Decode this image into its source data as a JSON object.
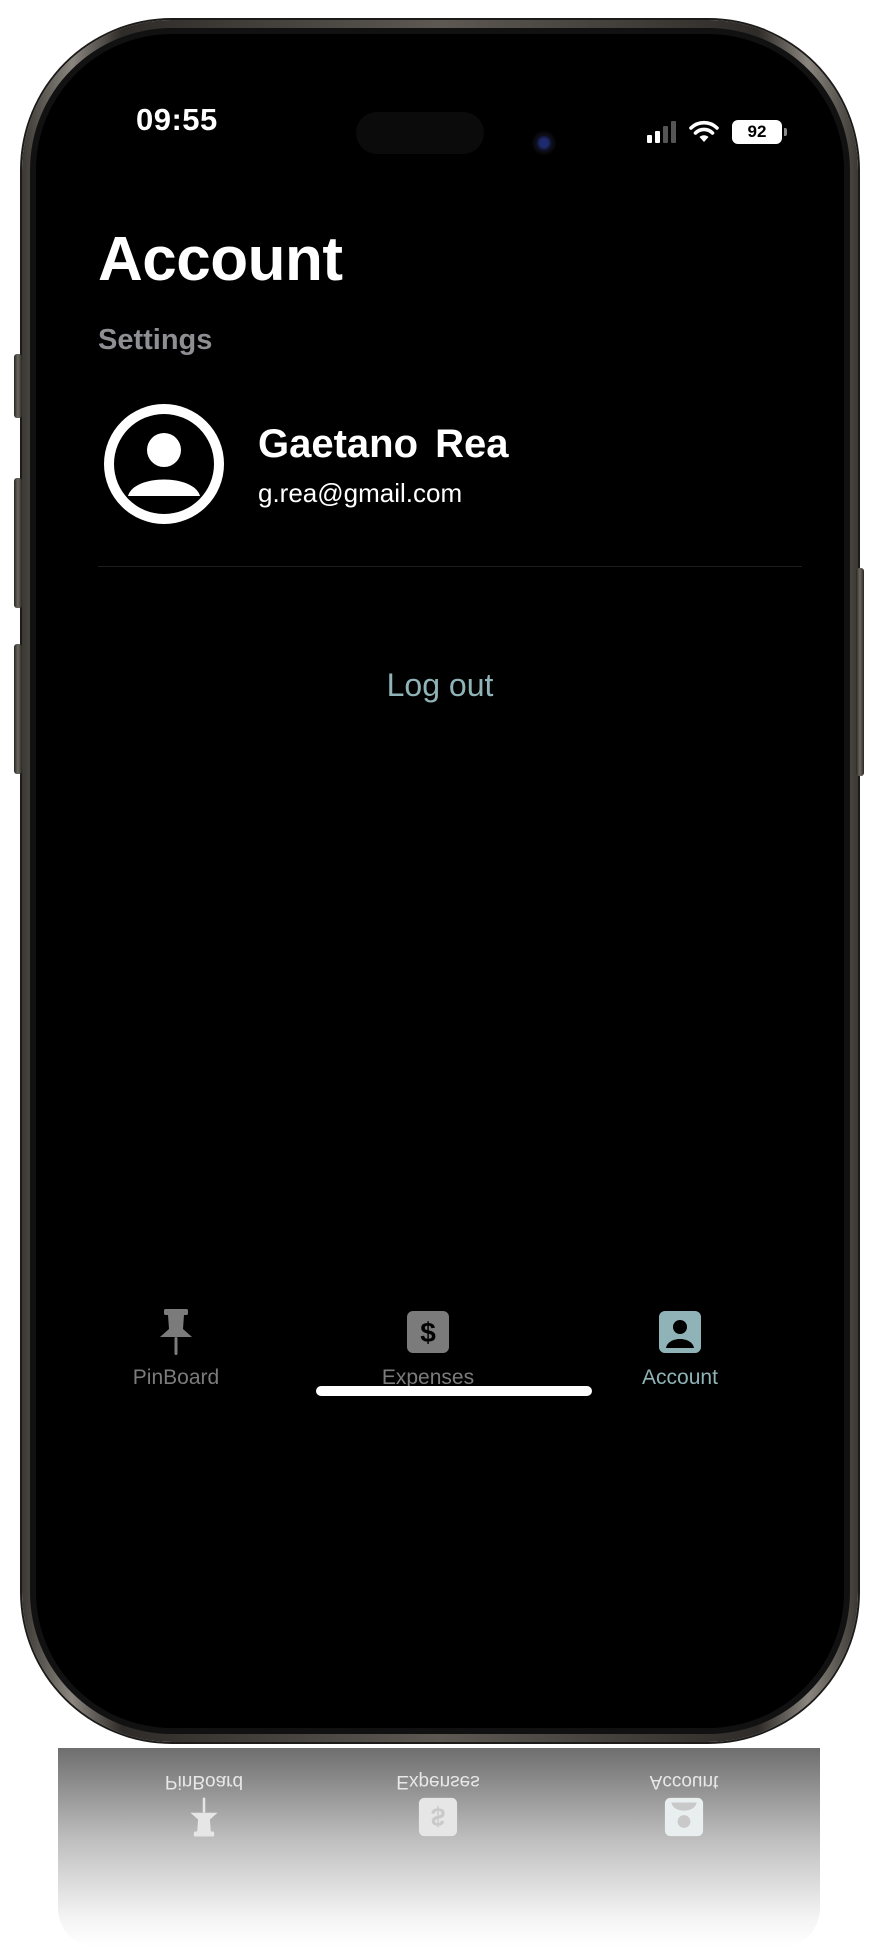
{
  "status_bar": {
    "time": "09:55",
    "battery": "92"
  },
  "page": {
    "title": "Account",
    "section_label": "Settings"
  },
  "profile": {
    "name": "Gaetano  Rea",
    "email": "g.rea@gmail.com"
  },
  "actions": {
    "logout_label": "Log out"
  },
  "tab_bar": {
    "tabs": [
      {
        "label": "PinBoard",
        "icon": "pushpin-icon",
        "active": false
      },
      {
        "label": "Expenses",
        "icon": "dollar-icon",
        "active": false
      },
      {
        "label": "Account",
        "icon": "person-icon",
        "active": true
      }
    ]
  },
  "colors": {
    "background": "#000000",
    "accent": "#8fb3b6",
    "inactive": "#7b7b7b",
    "secondary_text": "#8e8e93"
  }
}
